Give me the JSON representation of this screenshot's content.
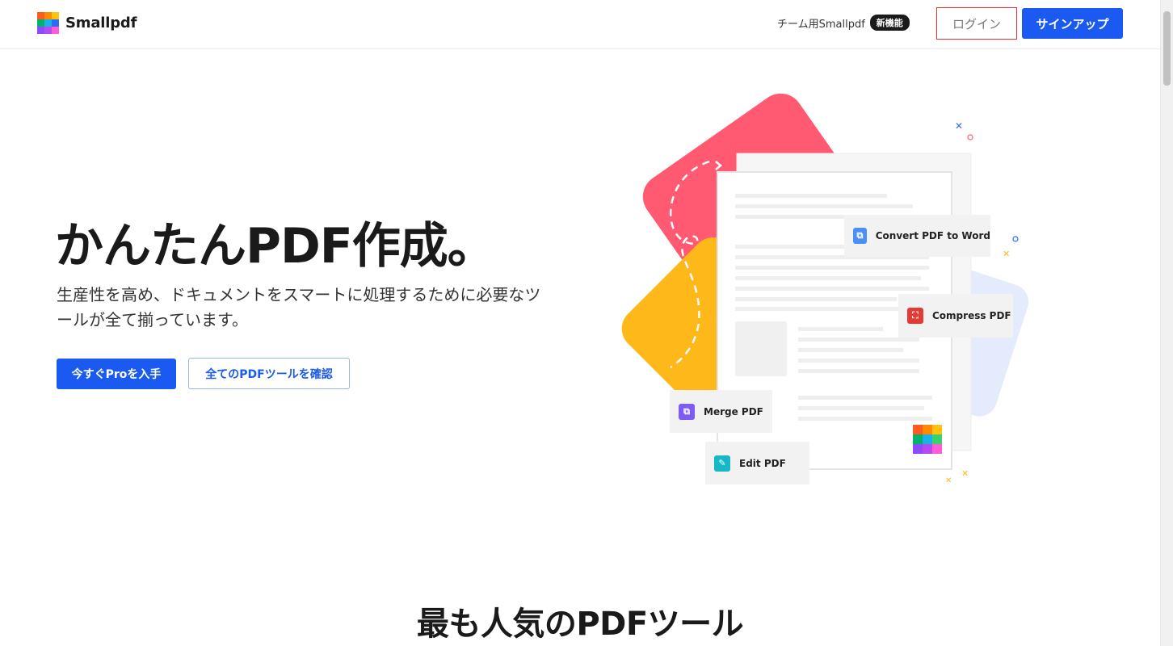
{
  "header": {
    "brand": "Smallpdf",
    "team_link": "チーム用Smallpdf",
    "new_badge": "新機能",
    "login_label": "ログイン",
    "signup_label": "サインアップ"
  },
  "brand_colors": [
    "#ff5a1f",
    "#ffc20e",
    "#00b36b",
    "#1ab0e8",
    "#2b6cf6",
    "#39d2c0",
    "#8c4bff",
    "#b34bf0",
    "#ff5cd6"
  ],
  "hero": {
    "title": "かんたんPDF作成。",
    "subtitle": "生産性を高め、ドキュメントをスマートに処理するために必要なツールが全て揃っています。",
    "primary_button": "今すぐProを入手",
    "secondary_button": "全てのPDFツールを確認"
  },
  "illustration": {
    "tools": [
      {
        "label": "Convert PDF to Word",
        "icon": "word-convert-icon",
        "color": "#4a8ff5"
      },
      {
        "label": "Compress PDF",
        "icon": "compress-icon",
        "color": "#e53935"
      },
      {
        "label": "Merge PDF",
        "icon": "merge-icon",
        "color": "#7e5cf2"
      },
      {
        "label": "Edit PDF",
        "icon": "edit-icon",
        "color": "#16b8c4"
      }
    ]
  },
  "popular_section": {
    "title": "最も人気のPDFツール"
  },
  "accent_color": "#1a5af0"
}
